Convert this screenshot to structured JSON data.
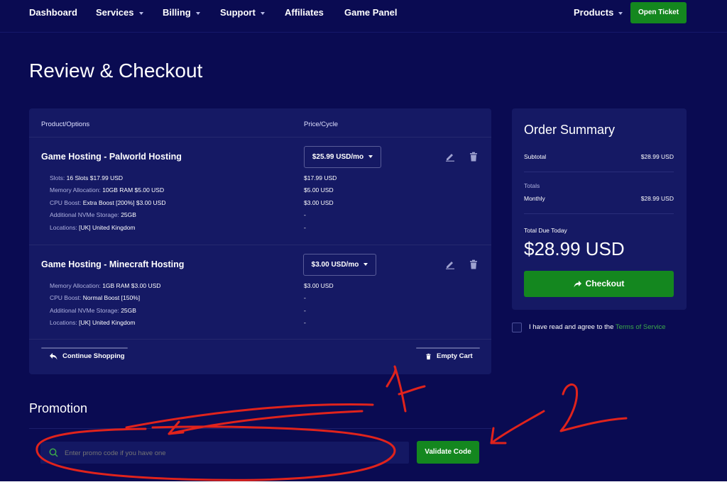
{
  "nav": {
    "items": [
      {
        "label": "Dashboard",
        "caret": false
      },
      {
        "label": "Services",
        "caret": true
      },
      {
        "label": "Billing",
        "caret": true
      },
      {
        "label": "Support",
        "caret": true
      },
      {
        "label": "Affiliates",
        "caret": false
      },
      {
        "label": "Game Panel",
        "caret": false
      }
    ],
    "products_label": "Products",
    "open_ticket_label": "Open Ticket"
  },
  "page": {
    "title": "Review & Checkout"
  },
  "cart": {
    "col_product": "Product/Options",
    "col_price": "Price/Cycle",
    "items": [
      {
        "name": "Game Hosting - Palworld Hosting",
        "cycle_price": "$25.99 USD/mo",
        "options": [
          {
            "key": "Slots:",
            "value": "16 Slots $17.99 USD",
            "price": "$17.99 USD"
          },
          {
            "key": "Memory Allocation:",
            "value": "10GB RAM $5.00 USD",
            "price": "$5.00 USD"
          },
          {
            "key": "CPU Boost:",
            "value": "Extra Boost [200%] $3.00 USD",
            "price": "$3.00 USD"
          },
          {
            "key": "Additional NVMe Storage:",
            "value": "25GB",
            "price": "-"
          },
          {
            "key": "Locations:",
            "value": "[UK] United Kingdom",
            "price": "-"
          }
        ]
      },
      {
        "name": "Game Hosting - Minecraft Hosting",
        "cycle_price": "$3.00 USD/mo",
        "options": [
          {
            "key": "Memory Allocation:",
            "value": "1GB RAM $3.00 USD",
            "price": "$3.00 USD"
          },
          {
            "key": "CPU Boost:",
            "value": "Normal Boost [150%]",
            "price": "-"
          },
          {
            "key": "Additional NVMe Storage:",
            "value": "25GB",
            "price": "-"
          },
          {
            "key": "Locations:",
            "value": "[UK] United Kingdom",
            "price": "-"
          }
        ]
      }
    ],
    "continue_label": "Continue Shopping",
    "empty_label": "Empty Cart"
  },
  "summary": {
    "title": "Order Summary",
    "subtotal_label": "Subtotal",
    "subtotal_value": "$28.99 USD",
    "totals_label": "Totals",
    "monthly_label": "Monthly",
    "monthly_value": "$28.99 USD",
    "due_label": "Total Due Today",
    "due_value": "$28.99 USD",
    "checkout_label": "Checkout"
  },
  "tos": {
    "text": "I have read and agree to the ",
    "link": "Terms of Service"
  },
  "promo": {
    "title": "Promotion",
    "placeholder": "Enter promo code if you have one",
    "validate_label": "Validate Code"
  },
  "annotations": {
    "label_one": "1",
    "label_two": "2"
  },
  "colors": {
    "background": "#0a0b52",
    "card": "#151964",
    "accent_green": "#14871f",
    "annotation_red": "#e0231c"
  }
}
